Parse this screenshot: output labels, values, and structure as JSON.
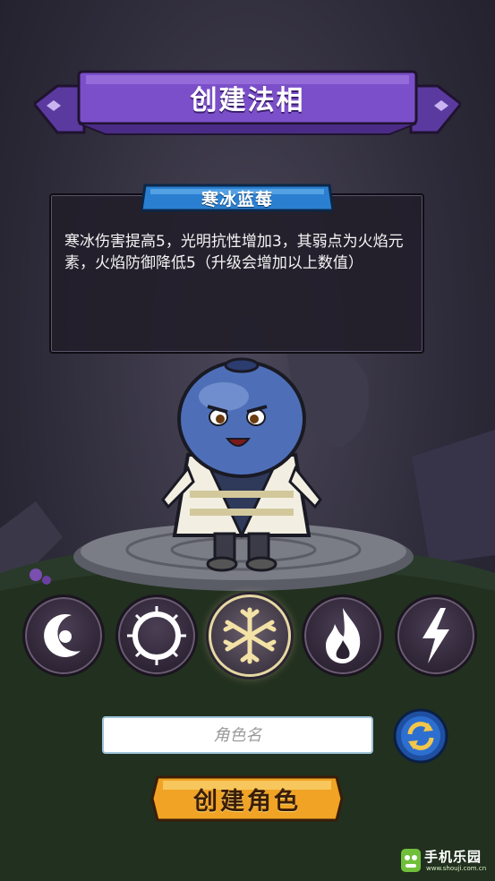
{
  "header": {
    "title": "创建法相"
  },
  "element_panel": {
    "name": "寒冰蓝莓",
    "description": "寒冰伤害提高5，光明抗性增加3，其弱点为火焰元素，火焰防御降低5（升级会增加以上数值）"
  },
  "elements": [
    {
      "icon": "moon-icon",
      "selected": false
    },
    {
      "icon": "sun-icon",
      "selected": false
    },
    {
      "icon": "snowflake-icon",
      "selected": true
    },
    {
      "icon": "fire-icon",
      "selected": false
    },
    {
      "icon": "lightning-icon",
      "selected": false
    }
  ],
  "name_field": {
    "placeholder": "角色名",
    "value": ""
  },
  "random_button": {
    "icon": "refresh-icon"
  },
  "create_button": {
    "label": "创建角色"
  },
  "watermark": {
    "text": "手机乐园",
    "url": "www.shouji.com.cn"
  },
  "colors": {
    "banner_purple": "#7b4fc9",
    "tab_blue": "#2a7fd0",
    "create_orange": "#f0a324",
    "selected_ring": "#e7d8a4"
  }
}
